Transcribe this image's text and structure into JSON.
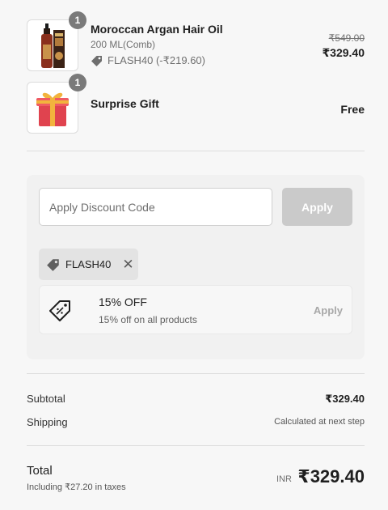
{
  "items": [
    {
      "title": "Moroccan Argan Hair Oil",
      "variant": "200 ML(Comb)",
      "quantity": "1",
      "discount_label": "FLASH40 (-₹219.60)",
      "price_original": "₹549.00",
      "price": "₹329.40",
      "image_icon": "argan-oil-bottle"
    },
    {
      "title": "Surprise Gift",
      "quantity": "1",
      "price": "Free",
      "image_icon": "gift-box"
    }
  ],
  "discount": {
    "placeholder": "Apply Discount Code",
    "apply_label": "Apply",
    "applied_code": "FLASH40",
    "offer": {
      "title": "15% OFF",
      "description": "15% off on all products",
      "apply_label": "Apply"
    }
  },
  "summary": {
    "subtotal_label": "Subtotal",
    "subtotal_value": "₹329.40",
    "shipping_label": "Shipping",
    "shipping_value": "Calculated at next step",
    "total_label": "Total",
    "tax_note": "Including ₹27.20 in taxes",
    "currency": "INR",
    "total_value": "₹329.40"
  },
  "colors": {
    "background": "#f7f7f7",
    "badge": "#7a7a7a",
    "apply_disabled": "#cacaca"
  }
}
